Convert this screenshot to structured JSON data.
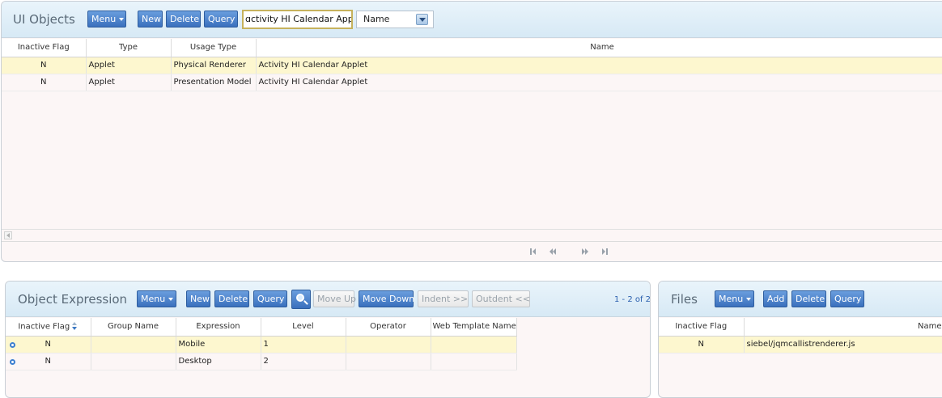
{
  "ui_objects": {
    "title": "UI Objects",
    "buttons": {
      "menu": "Menu",
      "new": "New",
      "delete": "Delete",
      "query": "Query"
    },
    "search_value": "ɑctivity HI Calendar Applet",
    "field_select": "Name",
    "columns": [
      "Inactive Flag",
      "Type",
      "Usage Type",
      "Name"
    ],
    "rows": [
      {
        "inactive_flag": "N",
        "type": "Applet",
        "usage_type": "Physical Renderer",
        "name": "Activity HI Calendar Applet"
      },
      {
        "inactive_flag": "N",
        "type": "Applet",
        "usage_type": "Presentation Model",
        "name": "Activity HI Calendar Applet"
      }
    ]
  },
  "object_expression": {
    "title": "Object Expression",
    "buttons": {
      "menu": "Menu",
      "new": "New",
      "delete": "Delete",
      "query": "Query",
      "move_up": "Move Up",
      "move_down": "Move Down",
      "indent": "Indent >>",
      "outdent": "Outdent <<"
    },
    "record_count": "1 - 2 of 2",
    "columns": [
      "Inactive Flag",
      "Group Name",
      "Expression",
      "Level",
      "Operator",
      "Web Template Name"
    ],
    "rows": [
      {
        "inactive_flag": "N",
        "group_name": "",
        "expression": "Mobile",
        "level": "1",
        "operator": "",
        "web_template_name": ""
      },
      {
        "inactive_flag": "N",
        "group_name": "",
        "expression": "Desktop",
        "level": "2",
        "operator": "",
        "web_template_name": ""
      }
    ]
  },
  "files": {
    "title": "Files",
    "buttons": {
      "menu": "Menu",
      "add": "Add",
      "delete": "Delete",
      "query": "Query"
    },
    "columns": [
      "Inactive Flag",
      "Name"
    ],
    "rows": [
      {
        "inactive_flag": "N",
        "name": "siebel/jqmcallistrenderer.js"
      }
    ]
  },
  "colors": {
    "button_blue": "#3a70bd",
    "selected_row": "#fdf7cf",
    "panel_background": "#fcf6f6",
    "header_gradient": "#d7e9f5"
  }
}
